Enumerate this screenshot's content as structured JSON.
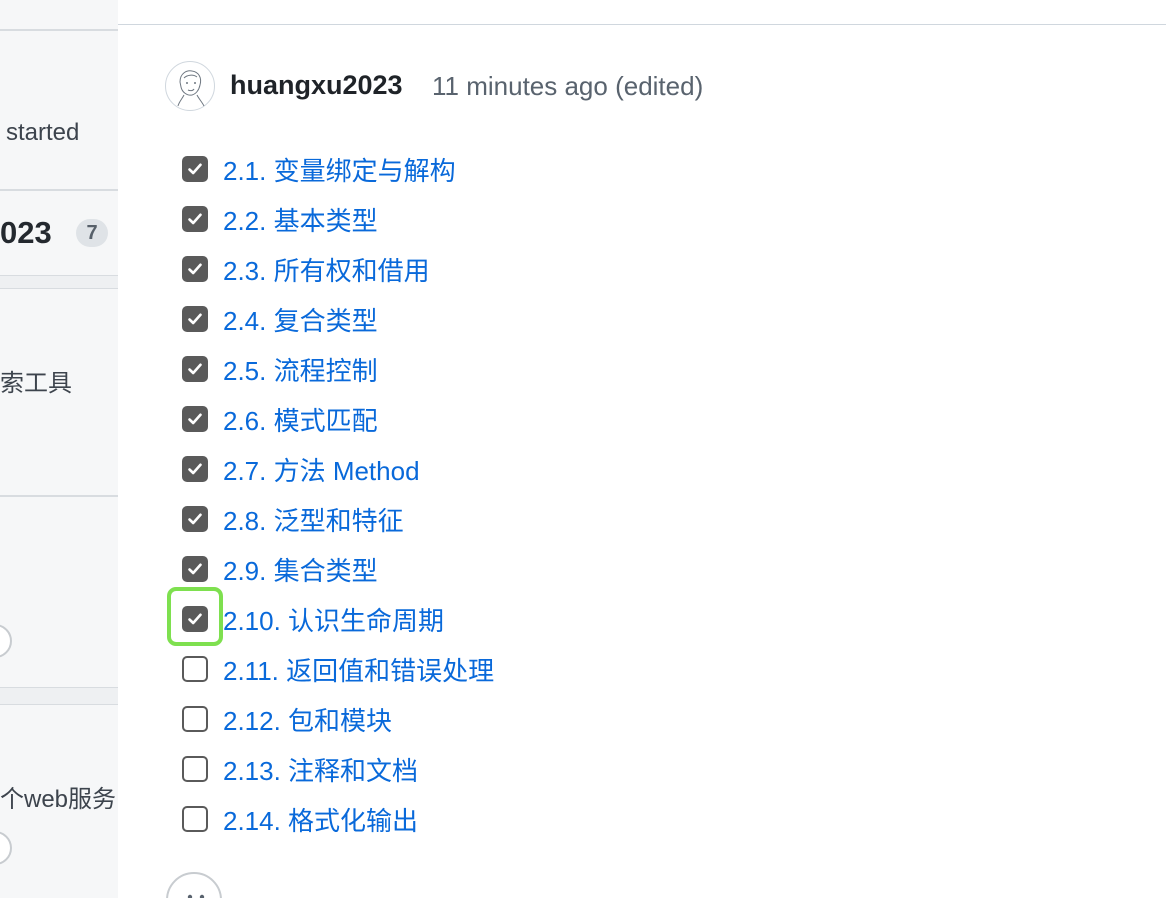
{
  "sidebar": {
    "fragment_started": "started",
    "fragment_user": "023",
    "fragment_badge": "7",
    "fragment_tool": "索工具",
    "fragment_web": "个web服务"
  },
  "comment": {
    "author": "huangxu2023",
    "meta": "11 minutes ago (edited)",
    "avatar_icon": "user-avatar-icon"
  },
  "tasks": [
    {
      "label": "2.1. 变量绑定与解构",
      "checked": true
    },
    {
      "label": "2.2. 基本类型",
      "checked": true
    },
    {
      "label": "2.3. 所有权和借用",
      "checked": true
    },
    {
      "label": "2.4. 复合类型",
      "checked": true
    },
    {
      "label": "2.5. 流程控制",
      "checked": true
    },
    {
      "label": "2.6. 模式匹配",
      "checked": true
    },
    {
      "label": "2.7. 方法 Method",
      "checked": true
    },
    {
      "label": "2.8. 泛型和特征",
      "checked": true
    },
    {
      "label": "2.9. 集合类型",
      "checked": true
    },
    {
      "label": "2.10. 认识生命周期",
      "checked": true
    },
    {
      "label": "2.11. 返回值和错误处理",
      "checked": false
    },
    {
      "label": "2.12. 包和模块",
      "checked": false
    },
    {
      "label": "2.13. 注释和文档",
      "checked": false
    },
    {
      "label": "2.14. 格式化输出",
      "checked": false
    }
  ],
  "colors": {
    "link": "#0969da",
    "checkbox": "#5a5a5a",
    "highlight": "#7ee04f"
  },
  "reaction_icon": "smiley-icon"
}
